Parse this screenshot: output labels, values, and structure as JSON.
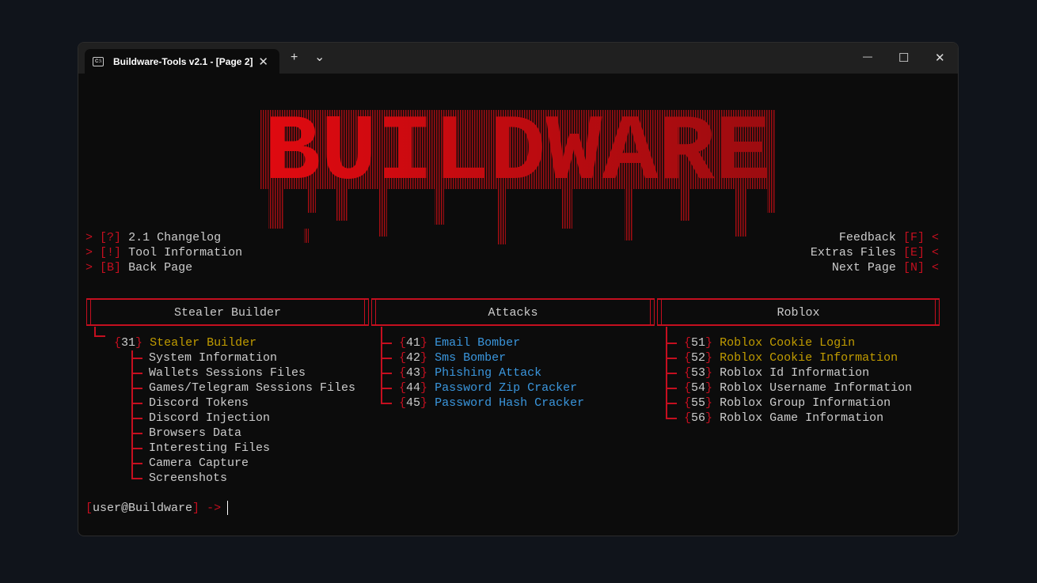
{
  "window": {
    "tab_title": "Buildware-Tools v2.1 - [Page 2]",
    "tab_icon": "terminal-icon",
    "new_tab": "+",
    "dropdown": "⌄",
    "minimize": "—",
    "maximize": "☐",
    "close": "✕"
  },
  "logo": {
    "text": "BUILDWARE"
  },
  "menu_left": [
    {
      "prefix": ">",
      "key": "[?]",
      "label": "2.1 Changelog"
    },
    {
      "prefix": ">",
      "key": "[!]",
      "label": "Tool Information"
    },
    {
      "prefix": ">",
      "key": "[B]",
      "label": "Back Page"
    }
  ],
  "menu_right": [
    {
      "label": "Feedback",
      "key": "[F]",
      "suffix": "<"
    },
    {
      "label": "Extras Files",
      "key": "[E]",
      "suffix": "<"
    },
    {
      "label": "Next Page",
      "key": "[N]",
      "suffix": "<"
    }
  ],
  "sections": [
    {
      "title": "Stealer Builder",
      "main": {
        "num": "{31}",
        "label": "Stealer Builder"
      },
      "items": [
        "System Information",
        "Wallets Sessions Files",
        "Games/Telegram Sessions Files",
        "Discord Tokens",
        "Discord Injection",
        "Browsers Data",
        "Interesting Files",
        "Camera Capture",
        "Screenshots"
      ]
    },
    {
      "title": "Attacks",
      "items": [
        {
          "num": "{41}",
          "label": "Email Bomber"
        },
        {
          "num": "{42}",
          "label": "Sms Bomber"
        },
        {
          "num": "{43}",
          "label": "Phishing Attack"
        },
        {
          "num": "{44}",
          "label": "Password Zip Cracker"
        },
        {
          "num": "{45}",
          "label": "Password Hash Cracker"
        }
      ]
    },
    {
      "title": "Roblox",
      "items": [
        {
          "num": "{51}",
          "label": "Roblox Cookie Login",
          "color": "y"
        },
        {
          "num": "{52}",
          "label": "Roblox Cookie Information",
          "color": "y"
        },
        {
          "num": "{53}",
          "label": "Roblox Id Information",
          "color": "w"
        },
        {
          "num": "{54}",
          "label": "Roblox Username Information",
          "color": "w"
        },
        {
          "num": "{55}",
          "label": "Roblox Group Information",
          "color": "w"
        },
        {
          "num": "{56}",
          "label": "Roblox Game Information",
          "color": "w"
        }
      ]
    }
  ],
  "prompt": {
    "open": "[",
    "user": "user@Buildware",
    "close": "]",
    "arrow": "->"
  },
  "colors": {
    "red": "#c50f1f",
    "yellow": "#c19c00",
    "blue": "#3a96dd",
    "text": "#cccccc"
  }
}
